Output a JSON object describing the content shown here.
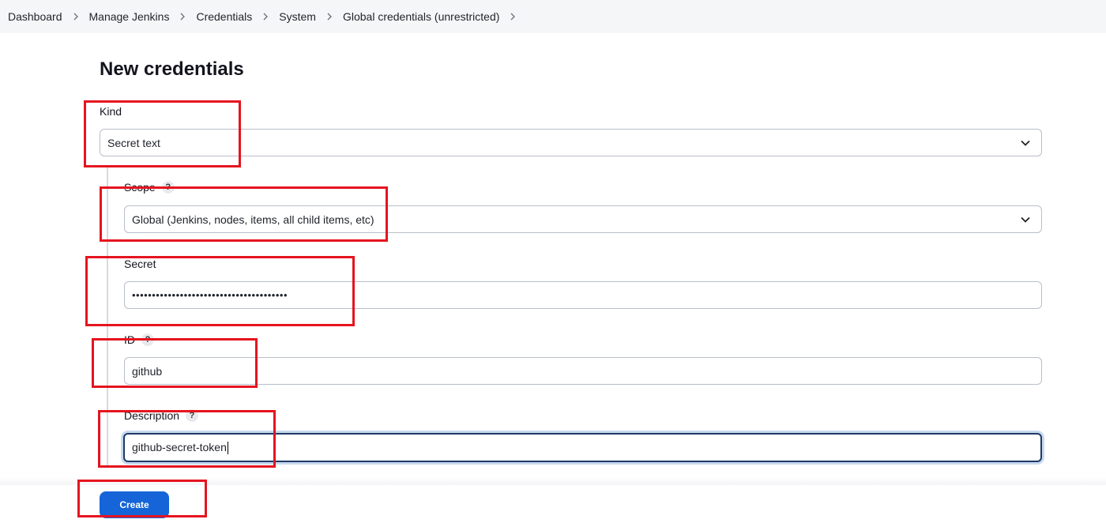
{
  "breadcrumb": {
    "items": [
      "Dashboard",
      "Manage Jenkins",
      "Credentials",
      "System",
      "Global credentials (unrestricted)"
    ]
  },
  "page": {
    "title": "New credentials"
  },
  "form": {
    "kind": {
      "label": "Kind",
      "value": "Secret text"
    },
    "scope": {
      "label": "Scope",
      "help": "?",
      "value": "Global (Jenkins, nodes, items, all child items, etc)"
    },
    "secret": {
      "label": "Secret",
      "value": "•••••••••••••••••••••••••••••••••••••••"
    },
    "id": {
      "label": "ID",
      "help": "?",
      "value": "github"
    },
    "description": {
      "label": "Description",
      "help": "?",
      "value_part1": "github",
      "value_part2": "-secret-token"
    }
  },
  "actions": {
    "create_label": "Create"
  },
  "colors": {
    "accent": "#1565d8",
    "annotation": "#e5141f",
    "breadcrumb_bg": "#f5f6f8"
  },
  "icons": [
    "chevron-right-icon",
    "chevron-down-icon",
    "help-icon"
  ]
}
